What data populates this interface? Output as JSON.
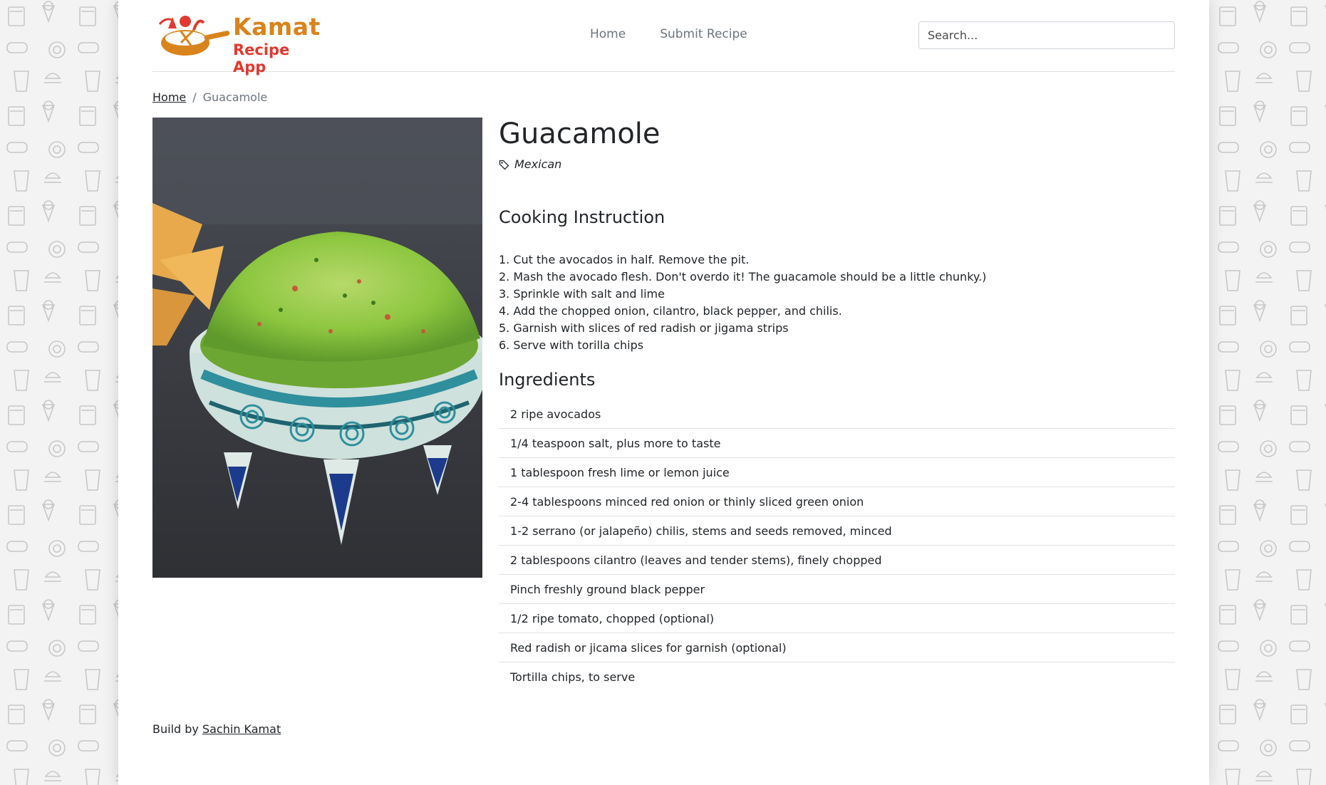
{
  "brand": {
    "title": "Kamat",
    "subtitle": "Recipe App"
  },
  "nav": {
    "home": "Home",
    "submit": "Submit Recipe"
  },
  "search": {
    "placeholder": "Search..."
  },
  "breadcrumb": {
    "home": "Home",
    "separator": "/",
    "current": "Guacamole"
  },
  "recipe": {
    "title": "Guacamole",
    "category": "Mexican",
    "instructions_heading": "Cooking Instruction",
    "steps": [
      "1. Cut the avocados in half. Remove the pit.",
      "2. Mash the avocado flesh. Don't overdo it! The guacamole should be a little chunky.)",
      "3. Sprinkle with salt and lime",
      "4. Add the chopped onion, cilantro, black pepper, and chilis.",
      "5. Garnish with slices of red radish or jigama strips",
      "6. Serve with torilla chips"
    ],
    "ingredients_heading": "Ingredients",
    "ingredients": [
      "2 ripe avocados",
      "1/4 teaspoon salt, plus more to taste",
      "1 tablespoon fresh lime or lemon juice",
      "2-4 tablespoons minced red onion or thinly sliced green onion",
      "1-2 serrano (or jalapeño) chilis, stems and seeds removed, minced",
      "2 tablespoons cilantro (leaves and tender stems), finely chopped",
      "Pinch freshly ground black pepper",
      "1/2 ripe tomato, chopped (optional)",
      "Red radish or jicama slices for garnish (optional)",
      "Tortilla chips, to serve"
    ]
  },
  "footer": {
    "prefix": "Build by",
    "author": "Sachin Kamat"
  },
  "colors": {
    "brand_orange": "#d9831c",
    "brand_red": "#e0392f",
    "guacamole_green": "#8cc63f",
    "bowl_teal": "#2f8f9d"
  }
}
